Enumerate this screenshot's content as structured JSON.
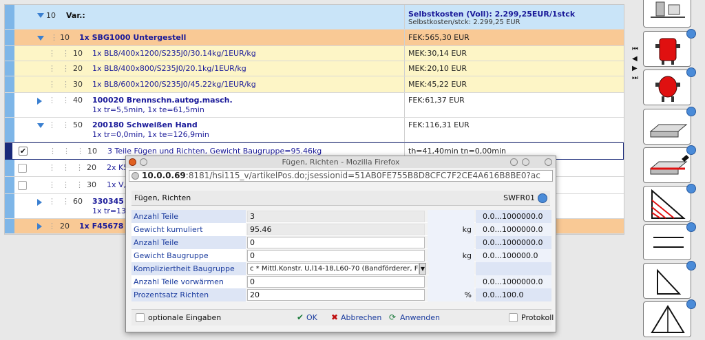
{
  "tree": {
    "rows": [
      {
        "num": "10",
        "label": "Var.:",
        "right1": "Selbstkosten (Voll): 2.299,25EUR/1stck",
        "right2": "Selbstkosten/stck: 2.299,25 EUR"
      },
      {
        "num": "10",
        "label": "1x SBG1000 Untergestell",
        "right1": "FEK:565,30 EUR"
      },
      {
        "num": "10",
        "label": "1x BL8/400x1200/S235J0/30.14kg/1EUR/kg",
        "right1": "MEK:30,14 EUR"
      },
      {
        "num": "20",
        "label": "1x BL8/400x800/S235J0/20.1kg/1EUR/kg",
        "right1": "MEK:20,10 EUR"
      },
      {
        "num": "30",
        "label": "1x BL8/600x1200/S235J0/45.22kg/1EUR/kg",
        "right1": "MEK:45,22 EUR"
      },
      {
        "num": "40",
        "label": "100020 Brennschn.autog.masch.",
        "sub": "1x tr=5,5min, 1x te=61,5min",
        "right1": "FEK:61,37 EUR"
      },
      {
        "num": "50",
        "label": "200180 Schweißen Hand",
        "sub": "1x tr=0,0min, 1x te=126,9min",
        "right1": "FEK:116,31 EUR"
      },
      {
        "num": "10",
        "label": "3 Teile Fügen und Richten, Gewicht Baugruppe=95.46kg",
        "right1": "th=41,40min tn=0,00min"
      },
      {
        "num": "20",
        "label": "2x K5"
      },
      {
        "num": "30",
        "label": "1x V,"
      },
      {
        "num": "60",
        "label": "330345 C",
        "sub": "1x tr=133"
      },
      {
        "num": "20",
        "label": "1x F45678 G"
      }
    ]
  },
  "popup": {
    "window_title": "Fügen, Richten - Mozilla Firefox",
    "url_host": "10.0.0.69",
    "url_rest": ":8181/hsi115_v/artikelPos.do;jsessionid=51AB0FE755B8D8CFC7F2CE4A616B8BE0?ac",
    "header_title": "Fügen, Richten",
    "header_code": "SWFR01",
    "fields": [
      {
        "label": "Anzahl Teile",
        "value": "3",
        "unit": "",
        "range": "0.0...1000000.0",
        "readonly": true
      },
      {
        "label": "Gewicht kumuliert",
        "value": "95.46",
        "unit": "kg",
        "range": "0.0...1000000.0",
        "readonly": true
      },
      {
        "label": "Anzahl Teile",
        "value": "0",
        "unit": "",
        "range": "0.0...1000000.0"
      },
      {
        "label": "Gewicht Baugruppe",
        "value": "0",
        "unit": "kg",
        "range": "0.0...100000.0"
      },
      {
        "label": "Kompliziertheit Baugruppe",
        "value": "c * Mittl.Konstr. U,l14-18,L60-70 (Bandförderer, F",
        "unit": "",
        "range": "",
        "select": true
      },
      {
        "label": "Anzahl Teile vorwärmen",
        "value": "0",
        "unit": "",
        "range": "0.0...1000000.0"
      },
      {
        "label": "Prozentsatz Richten",
        "value": "20",
        "unit": "%",
        "range": "0.0...100.0"
      }
    ],
    "footer": {
      "optional": "optionale Eingaben",
      "ok": "OK",
      "cancel": "Abbrechen",
      "apply": "Anwenden",
      "protocol": "Protokoll"
    }
  },
  "colors": {
    "blue_row": "#c9e4f8",
    "orange_row": "#f9c995",
    "yellow_row": "#fdf5c6",
    "accent": "#3a7fd0"
  }
}
